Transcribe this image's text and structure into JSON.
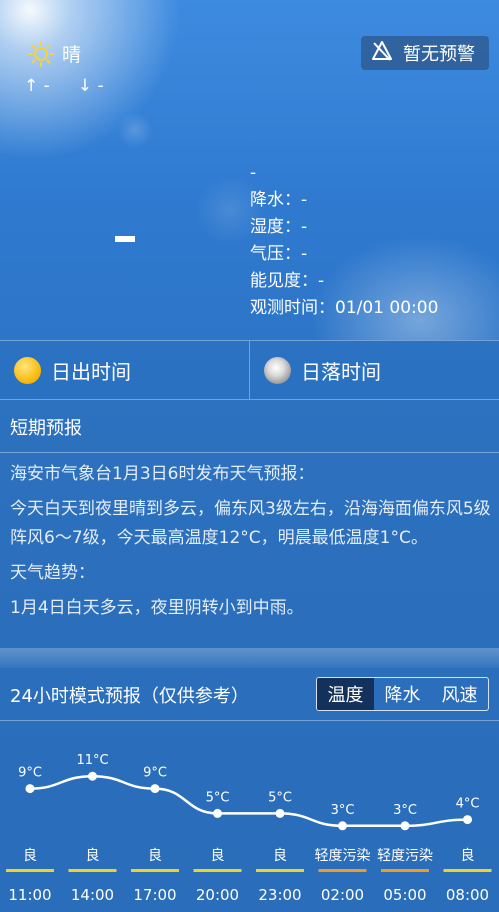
{
  "current": {
    "weather": "晴",
    "weather_icon": "sun-icon",
    "high_label": "↑ -",
    "low_label": "↓ -",
    "warning": "暂无预警",
    "warning_icon": "no-warning-icon"
  },
  "observation": {
    "condition": "-",
    "precip": "降水：-",
    "humidity": "湿度：-",
    "pressure": "气压：-",
    "visibility": "能见度：-",
    "obs_time": "观测时间：01/01 00:00"
  },
  "sun": {
    "sunrise": "日出时间",
    "sunset": "日落时间"
  },
  "short_forecast": {
    "title": "短期预报",
    "publisher": "海安市气象台1月3日6时发布天气预报：",
    "body": "今天白天到夜里晴到多云，偏东风3级左右，沿海海面偏东风5级阵风6～7级，今天最高温度12°C，明晨最低温度1°C。",
    "trend_title": "天气趋势：",
    "trend": "1月4日白天多云，夜里阴转小到中雨。"
  },
  "hourly": {
    "title": "24小时模式预报（仅供参考）",
    "tabs": [
      "温度",
      "降水",
      "风速"
    ],
    "active_tab": 0
  },
  "chart_data": {
    "type": "line",
    "x": [
      "11:00",
      "14:00",
      "17:00",
      "20:00",
      "23:00",
      "02:00",
      "05:00",
      "08:00"
    ],
    "series": [
      {
        "values": [
          9,
          11,
          9,
          5,
          5,
          3,
          3,
          4
        ]
      }
    ],
    "point_labels": [
      "9°C",
      "11°C",
      "9°C",
      "5°C",
      "5°C",
      "3°C",
      "3°C",
      "4°C"
    ],
    "air_quality": [
      "良",
      "良",
      "良",
      "良",
      "良",
      "轻度污染",
      "轻度污染",
      "良"
    ],
    "air_colors": [
      "#f2d21e",
      "#f2d21e",
      "#f2d21e",
      "#f2d21e",
      "#f2d21e",
      "#f29a1e",
      "#f29a1e",
      "#f2d21e"
    ],
    "line_color": "#ffffff"
  }
}
